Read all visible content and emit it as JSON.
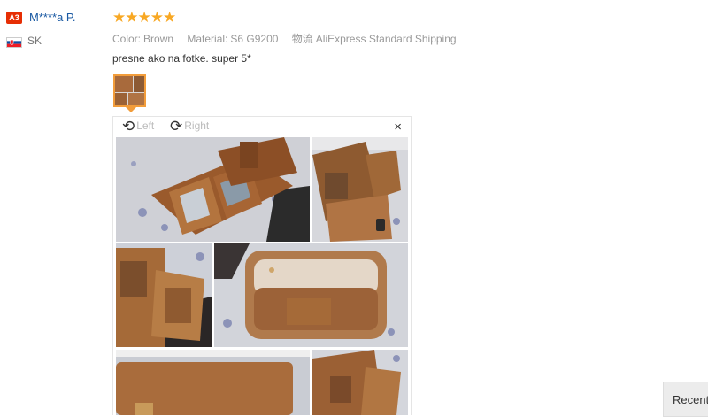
{
  "reviewer": {
    "badge": "A3",
    "name": "M****a P.",
    "country": "SK",
    "flag_icon": "slovakia-flag-icon",
    "badge_color": "#e62e04",
    "name_color": "#1b5aa3"
  },
  "review": {
    "stars_text": "★★★★★",
    "rating": 5,
    "star_color": "#f8a824",
    "attributes": [
      {
        "label": "Color:",
        "value": "Brown"
      },
      {
        "label": "Material:",
        "value": "S6 G9200"
      },
      {
        "label": "物流",
        "value": "AliExpress Standard Shipping"
      }
    ],
    "text": "presne ako na fotke. super 5*"
  },
  "viewer": {
    "rotate_left_icon": "rotate-left-icon",
    "rotate_left_label": "Left",
    "rotate_right_icon": "rotate-right-icon",
    "rotate_right_label": "Right",
    "close_icon": "close-icon",
    "close_glyph": "×"
  },
  "sidebar": {
    "recent_label": "Recent"
  }
}
